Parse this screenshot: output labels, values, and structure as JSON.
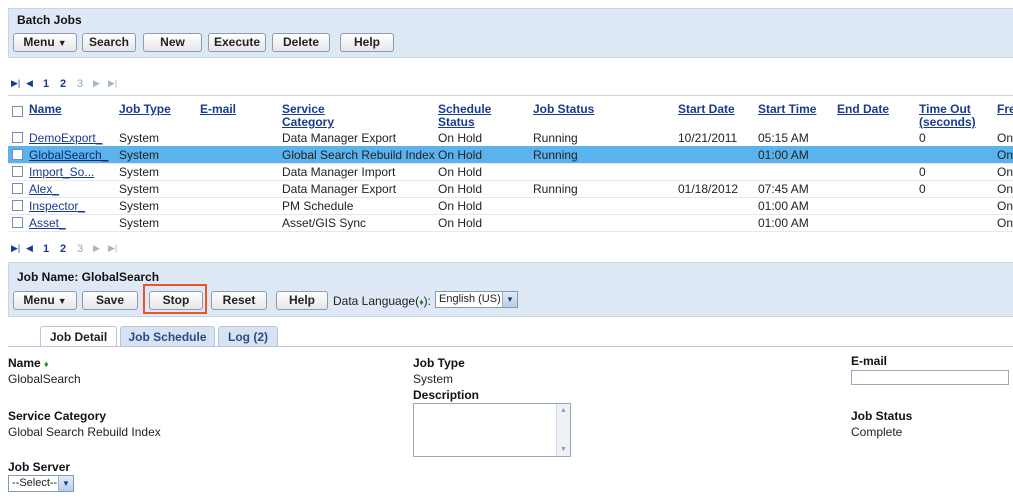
{
  "batch_panel": {
    "title": "Batch Jobs",
    "buttons": [
      "Menu",
      "Search",
      "New",
      "Execute",
      "Delete",
      "Help"
    ]
  },
  "pager": {
    "first_icon": "first-page-icon",
    "prev_icon": "prev-page-icon",
    "pages": [
      "1",
      "2",
      "3"
    ],
    "next_icon": "next-page-icon",
    "last_icon": "last-page-icon"
  },
  "table": {
    "headers": {
      "name": "Name",
      "job_type": "Job Type",
      "email": "E-mail",
      "service_category": "Service Category",
      "schedule_status": "Schedule Status",
      "job_status": "Job Status",
      "start_date": "Start Date",
      "start_time": "Start Time",
      "end_date": "End Date",
      "timeout": "Time Out (seconds)",
      "frequency": "Fre"
    },
    "rows": [
      {
        "name": "DemoExport_",
        "job_type": "System",
        "email": "",
        "service_category": "Data Manager Export",
        "schedule_status": "On Hold",
        "job_status": "Running",
        "start_date": "10/21/2011",
        "start_time": "05:15 AM",
        "end_date": "",
        "timeout": "0",
        "frequency": "On"
      },
      {
        "name": "GlobalSearch_",
        "job_type": "System",
        "email": "",
        "service_category": "Global Search Rebuild Index",
        "schedule_status": "On Hold",
        "job_status": "Running",
        "start_date": "",
        "start_time": "01:00 AM",
        "end_date": "",
        "timeout": "",
        "frequency": "On",
        "selected": true
      },
      {
        "name": "Import_So...",
        "job_type": "System",
        "email": "",
        "service_category": "Data Manager Import",
        "schedule_status": "On Hold",
        "job_status": "",
        "start_date": "",
        "start_time": "",
        "end_date": "",
        "timeout": "0",
        "frequency": "On"
      },
      {
        "name": "Alex_",
        "job_type": "System",
        "email": "",
        "service_category": "Data Manager Export",
        "schedule_status": "On Hold",
        "job_status": "Running",
        "start_date": "01/18/2012",
        "start_time": "07:45 AM",
        "end_date": "",
        "timeout": "0",
        "frequency": "On"
      },
      {
        "name": "Inspector_",
        "job_type": "System",
        "email": "",
        "service_category": "PM Schedule",
        "schedule_status": "On Hold",
        "job_status": "",
        "start_date": "",
        "start_time": "01:00 AM",
        "end_date": "",
        "timeout": "",
        "frequency": "On"
      },
      {
        "name": "Asset_",
        "job_type": "System",
        "email": "",
        "service_category": "Asset/GIS Sync",
        "schedule_status": "On Hold",
        "job_status": "",
        "start_date": "",
        "start_time": "01:00 AM",
        "end_date": "",
        "timeout": "",
        "frequency": "On"
      }
    ]
  },
  "job_panel": {
    "title": "Job Name: GlobalSearch",
    "buttons": [
      "Menu",
      "Save",
      "Stop",
      "Reset",
      "Help"
    ],
    "data_language_label": "Data Language(",
    "data_language_req": "♦",
    "data_language_label_end": "):",
    "data_language_value": "English (US)"
  },
  "tabs": [
    "Job Detail",
    "Job Schedule",
    "Log (2)"
  ],
  "detail": {
    "name_label": "Name",
    "name_req": "♦",
    "name_value": "GlobalSearch",
    "job_type_label": "Job Type",
    "job_type_value": "System",
    "email_label": "E-mail",
    "email_value": "",
    "description_label": "Description",
    "description_value": "",
    "service_category_label": "Service Category",
    "service_category_value": "Global Search Rebuild Index",
    "job_status_label": "Job Status",
    "job_status_value": "Complete",
    "job_server_label": "Job Server",
    "job_server_value": "--Select--"
  },
  "colors": {
    "panel_bg": "#dfe9f5",
    "selected_row": "#5bb3ee",
    "link": "#1a3a8f",
    "highlight": "#e8552a"
  }
}
